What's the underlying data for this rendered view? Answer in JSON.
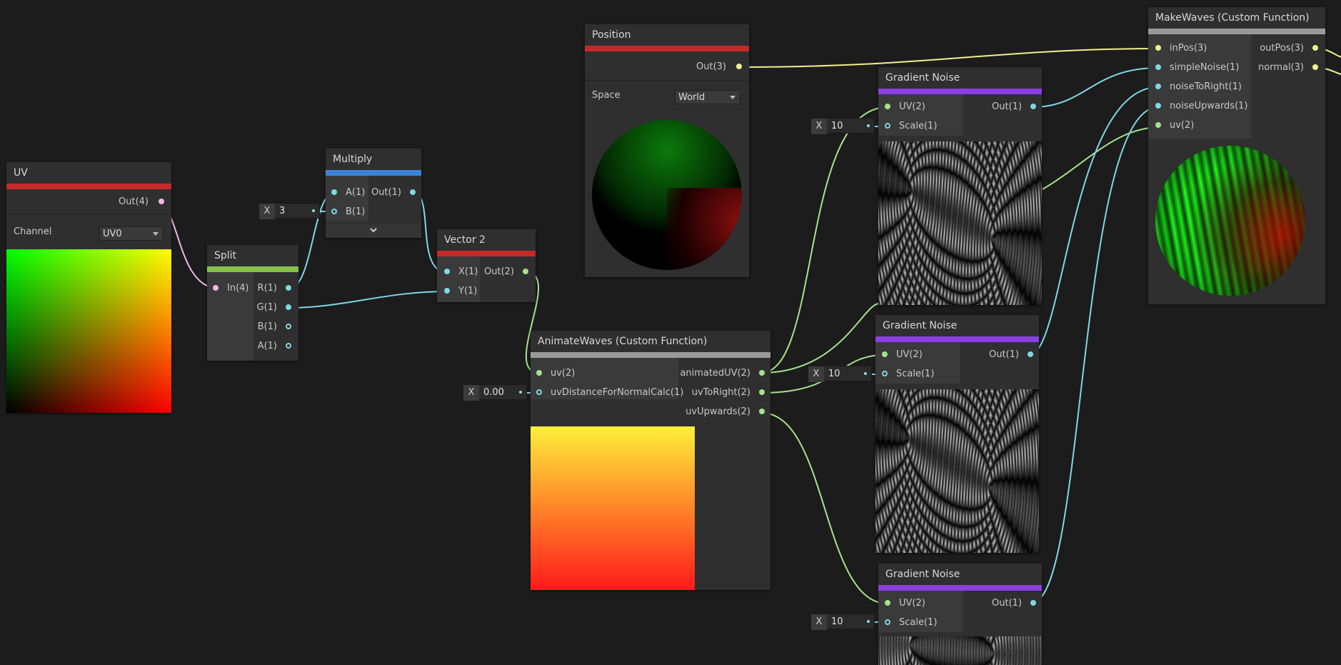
{
  "colors": {
    "wire_vector1": "#7fd8e4",
    "wire_vector2": "#a6e38e",
    "wire_vector3": "#f0f08c",
    "wire_vector4": "#f1b7e3",
    "bar_input": "#c52a2a",
    "bar_math": "#3b83d9",
    "bar_channel": "#86c14a",
    "bar_procedural": "#8a3fe0",
    "bar_custom": "#9a9a9a"
  },
  "nodes": {
    "uv": {
      "title": "UV",
      "out": "Out(4)",
      "channel_label": "Channel",
      "channel_value": "UV0"
    },
    "split": {
      "title": "Split",
      "in": "In(4)",
      "outs": [
        "R(1)",
        "G(1)",
        "B(1)",
        "A(1)"
      ]
    },
    "multiply": {
      "title": "Multiply",
      "ins": [
        "A(1)",
        "B(1)"
      ],
      "out": "Out(1)",
      "b_inline": {
        "label": "X",
        "value": "3"
      }
    },
    "vector2": {
      "title": "Vector 2",
      "ins": [
        "X(1)",
        "Y(1)"
      ],
      "out": "Out(2)"
    },
    "position": {
      "title": "Position",
      "out": "Out(3)",
      "space_label": "Space",
      "space_value": "World"
    },
    "animate_waves": {
      "title": "AnimateWaves (Custom Function)",
      "ins": [
        "uv(2)",
        "uvDistanceForNormalCalc(1)"
      ],
      "outs": [
        "animatedUV(2)",
        "uvToRight(2)",
        "uvUpwards(2)"
      ],
      "dist_inline": {
        "label": "X",
        "value": "0.00"
      }
    },
    "gradient_noise_1": {
      "title": "Gradient Noise",
      "ins": [
        "UV(2)",
        "Scale(1)"
      ],
      "out": "Out(1)",
      "scale_inline": {
        "label": "X",
        "value": "10"
      }
    },
    "gradient_noise_2": {
      "title": "Gradient Noise",
      "ins": [
        "UV(2)",
        "Scale(1)"
      ],
      "out": "Out(1)",
      "scale_inline": {
        "label": "X",
        "value": "10"
      }
    },
    "gradient_noise_3": {
      "title": "Gradient Noise",
      "ins": [
        "UV(2)",
        "Scale(1)"
      ],
      "out": "Out(1)",
      "scale_inline": {
        "label": "X",
        "value": "10"
      }
    },
    "make_waves": {
      "title": "MakeWaves (Custom Function)",
      "ins": [
        "inPos(3)",
        "simpleNoise(1)",
        "noiseToRight(1)",
        "noiseUpwards(1)",
        "uv(2)"
      ],
      "outs": [
        "outPos(3)",
        "normal(3)"
      ]
    }
  }
}
